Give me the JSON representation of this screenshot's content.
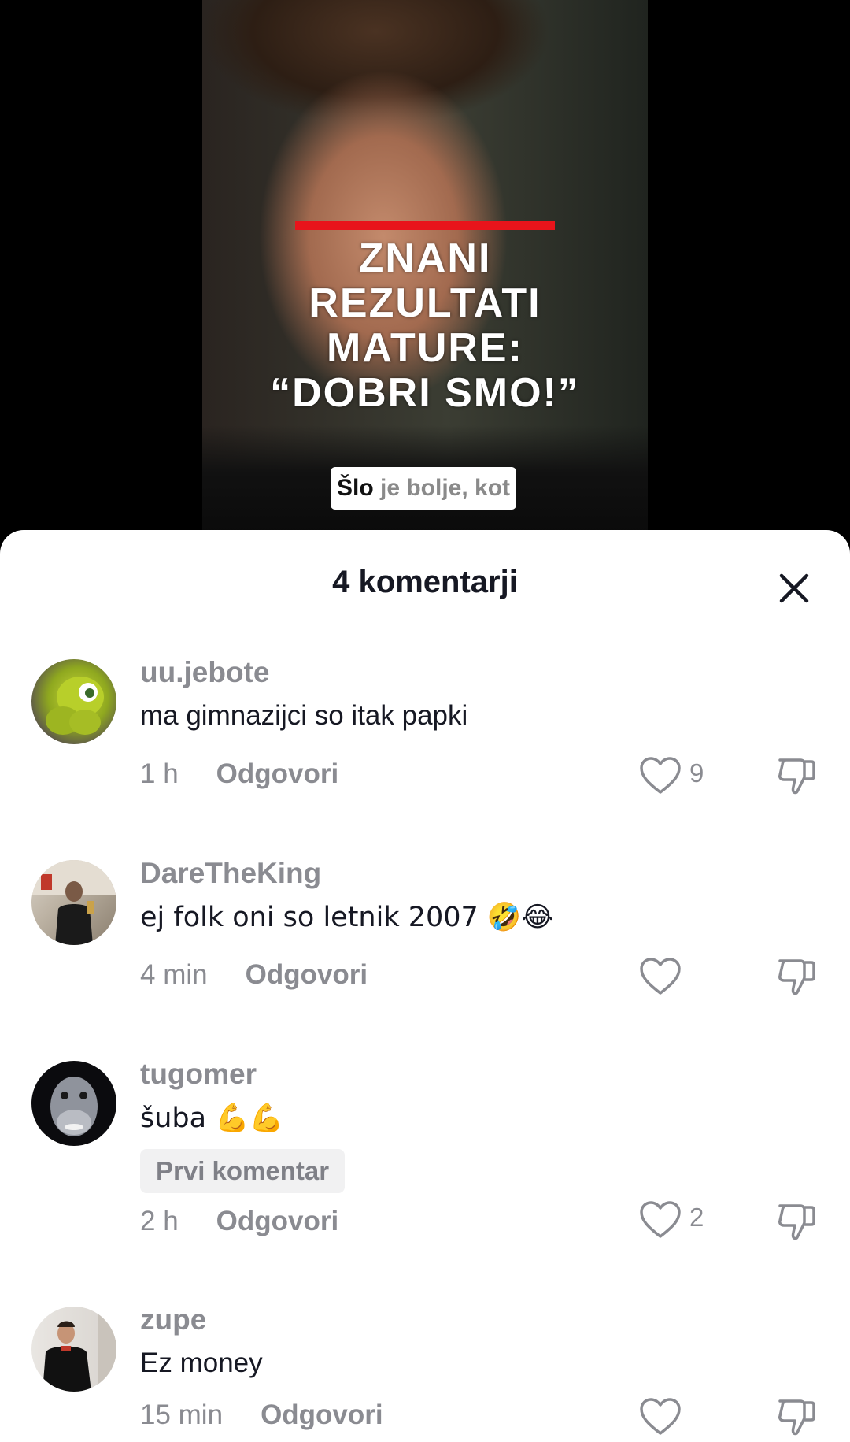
{
  "video": {
    "headline": [
      "ZNANI",
      "REZULTATI",
      "MATURE:",
      "“DOBRI SMO!”"
    ],
    "caption_bold": "Šlo",
    "caption_rest": " je bolje, kot"
  },
  "sheet": {
    "title": "4 komentarji"
  },
  "comments": [
    {
      "username": "uu.jebote",
      "text": "ma gimnazijci so itak papki",
      "time": "1 h",
      "reply": "Odgovori",
      "likes": "9"
    },
    {
      "username": "DareTheKing",
      "text": "ej folk oni so letnik 2007 🤣😂",
      "time": "4 min",
      "reply": "Odgovori",
      "likes": ""
    },
    {
      "username": "tugomer",
      "text": "šuba 💪💪",
      "badge": "Prvi komentar",
      "time": "2 h",
      "reply": "Odgovori",
      "likes": "2"
    },
    {
      "username": "zupe",
      "text": "Ez money",
      "time": "15 min",
      "reply": "Odgovori",
      "likes": ""
    }
  ],
  "icons": {
    "close": "close-icon",
    "like": "heart-outline-icon",
    "dislike": "thumbs-down-outline-icon"
  },
  "colors": {
    "accent_red": "#e8141b",
    "muted_text": "#8a8b91",
    "primary_text": "#161823"
  }
}
